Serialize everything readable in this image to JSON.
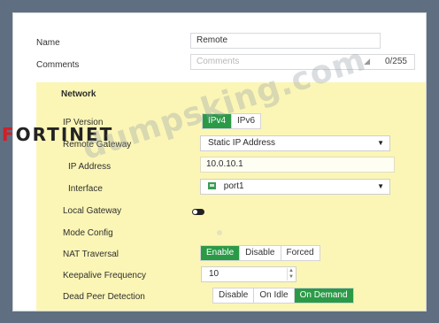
{
  "form": {
    "name_label": "Name",
    "name_value": "Remote",
    "comments_label": "Comments",
    "comments_placeholder": "Comments",
    "comments_counter": "0/255"
  },
  "network": {
    "title": "Network",
    "ip_version": {
      "label": "IP Version",
      "options": [
        "IPv4",
        "IPv6"
      ],
      "selected": "IPv4"
    },
    "remote_gateway": {
      "label": "Remote Gateway",
      "value": "Static IP Address"
    },
    "ip_address": {
      "label": "IP Address",
      "value": "10.0.10.1"
    },
    "interface": {
      "label": "Interface",
      "value": "port1",
      "icon": "port-icon"
    },
    "local_gateway": {
      "label": "Local Gateway",
      "enabled": true
    },
    "mode_config": {
      "label": "Mode Config",
      "enabled": false
    },
    "nat_traversal": {
      "label": "NAT Traversal",
      "options": [
        "Enable",
        "Disable",
        "Forced"
      ],
      "selected": "Enable"
    },
    "keepalive": {
      "label": "Keepalive Frequency",
      "value": "10"
    },
    "dpd": {
      "label": "Dead Peer Detection",
      "options": [
        "Disable",
        "On Idle",
        "On Demand"
      ],
      "selected": "On Demand"
    }
  },
  "watermark": {
    "brand": "FORTINET",
    "text": "dumpsking.com"
  },
  "colors": {
    "accent_green": "#2b9a47",
    "panel_yellow": "#fbf6b6",
    "background": "#5f6e80"
  }
}
